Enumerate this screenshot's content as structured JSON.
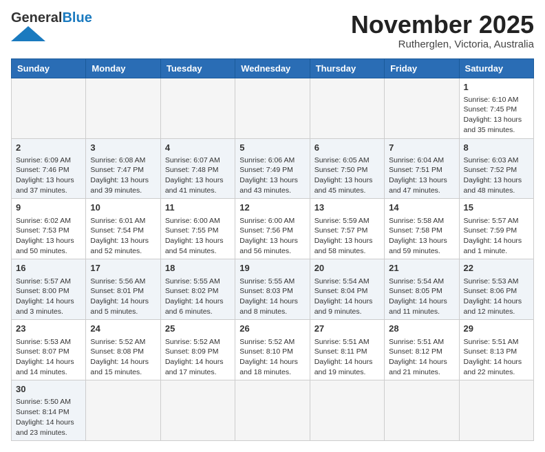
{
  "header": {
    "logo_general": "General",
    "logo_blue": "Blue",
    "month_title": "November 2025",
    "location": "Rutherglen, Victoria, Australia"
  },
  "weekdays": [
    "Sunday",
    "Monday",
    "Tuesday",
    "Wednesday",
    "Thursday",
    "Friday",
    "Saturday"
  ],
  "weeks": [
    [
      {
        "day": "",
        "info": ""
      },
      {
        "day": "",
        "info": ""
      },
      {
        "day": "",
        "info": ""
      },
      {
        "day": "",
        "info": ""
      },
      {
        "day": "",
        "info": ""
      },
      {
        "day": "",
        "info": ""
      },
      {
        "day": "1",
        "info": "Sunrise: 6:10 AM\nSunset: 7:45 PM\nDaylight: 13 hours and 35 minutes."
      }
    ],
    [
      {
        "day": "2",
        "info": "Sunrise: 6:09 AM\nSunset: 7:46 PM\nDaylight: 13 hours and 37 minutes."
      },
      {
        "day": "3",
        "info": "Sunrise: 6:08 AM\nSunset: 7:47 PM\nDaylight: 13 hours and 39 minutes."
      },
      {
        "day": "4",
        "info": "Sunrise: 6:07 AM\nSunset: 7:48 PM\nDaylight: 13 hours and 41 minutes."
      },
      {
        "day": "5",
        "info": "Sunrise: 6:06 AM\nSunset: 7:49 PM\nDaylight: 13 hours and 43 minutes."
      },
      {
        "day": "6",
        "info": "Sunrise: 6:05 AM\nSunset: 7:50 PM\nDaylight: 13 hours and 45 minutes."
      },
      {
        "day": "7",
        "info": "Sunrise: 6:04 AM\nSunset: 7:51 PM\nDaylight: 13 hours and 47 minutes."
      },
      {
        "day": "8",
        "info": "Sunrise: 6:03 AM\nSunset: 7:52 PM\nDaylight: 13 hours and 48 minutes."
      }
    ],
    [
      {
        "day": "9",
        "info": "Sunrise: 6:02 AM\nSunset: 7:53 PM\nDaylight: 13 hours and 50 minutes."
      },
      {
        "day": "10",
        "info": "Sunrise: 6:01 AM\nSunset: 7:54 PM\nDaylight: 13 hours and 52 minutes."
      },
      {
        "day": "11",
        "info": "Sunrise: 6:00 AM\nSunset: 7:55 PM\nDaylight: 13 hours and 54 minutes."
      },
      {
        "day": "12",
        "info": "Sunrise: 6:00 AM\nSunset: 7:56 PM\nDaylight: 13 hours and 56 minutes."
      },
      {
        "day": "13",
        "info": "Sunrise: 5:59 AM\nSunset: 7:57 PM\nDaylight: 13 hours and 58 minutes."
      },
      {
        "day": "14",
        "info": "Sunrise: 5:58 AM\nSunset: 7:58 PM\nDaylight: 13 hours and 59 minutes."
      },
      {
        "day": "15",
        "info": "Sunrise: 5:57 AM\nSunset: 7:59 PM\nDaylight: 14 hours and 1 minute."
      }
    ],
    [
      {
        "day": "16",
        "info": "Sunrise: 5:57 AM\nSunset: 8:00 PM\nDaylight: 14 hours and 3 minutes."
      },
      {
        "day": "17",
        "info": "Sunrise: 5:56 AM\nSunset: 8:01 PM\nDaylight: 14 hours and 5 minutes."
      },
      {
        "day": "18",
        "info": "Sunrise: 5:55 AM\nSunset: 8:02 PM\nDaylight: 14 hours and 6 minutes."
      },
      {
        "day": "19",
        "info": "Sunrise: 5:55 AM\nSunset: 8:03 PM\nDaylight: 14 hours and 8 minutes."
      },
      {
        "day": "20",
        "info": "Sunrise: 5:54 AM\nSunset: 8:04 PM\nDaylight: 14 hours and 9 minutes."
      },
      {
        "day": "21",
        "info": "Sunrise: 5:54 AM\nSunset: 8:05 PM\nDaylight: 14 hours and 11 minutes."
      },
      {
        "day": "22",
        "info": "Sunrise: 5:53 AM\nSunset: 8:06 PM\nDaylight: 14 hours and 12 minutes."
      }
    ],
    [
      {
        "day": "23",
        "info": "Sunrise: 5:53 AM\nSunset: 8:07 PM\nDaylight: 14 hours and 14 minutes."
      },
      {
        "day": "24",
        "info": "Sunrise: 5:52 AM\nSunset: 8:08 PM\nDaylight: 14 hours and 15 minutes."
      },
      {
        "day": "25",
        "info": "Sunrise: 5:52 AM\nSunset: 8:09 PM\nDaylight: 14 hours and 17 minutes."
      },
      {
        "day": "26",
        "info": "Sunrise: 5:52 AM\nSunset: 8:10 PM\nDaylight: 14 hours and 18 minutes."
      },
      {
        "day": "27",
        "info": "Sunrise: 5:51 AM\nSunset: 8:11 PM\nDaylight: 14 hours and 19 minutes."
      },
      {
        "day": "28",
        "info": "Sunrise: 5:51 AM\nSunset: 8:12 PM\nDaylight: 14 hours and 21 minutes."
      },
      {
        "day": "29",
        "info": "Sunrise: 5:51 AM\nSunset: 8:13 PM\nDaylight: 14 hours and 22 minutes."
      }
    ],
    [
      {
        "day": "30",
        "info": "Sunrise: 5:50 AM\nSunset: 8:14 PM\nDaylight: 14 hours and 23 minutes."
      },
      {
        "day": "",
        "info": ""
      },
      {
        "day": "",
        "info": ""
      },
      {
        "day": "",
        "info": ""
      },
      {
        "day": "",
        "info": ""
      },
      {
        "day": "",
        "info": ""
      },
      {
        "day": "",
        "info": ""
      }
    ]
  ]
}
